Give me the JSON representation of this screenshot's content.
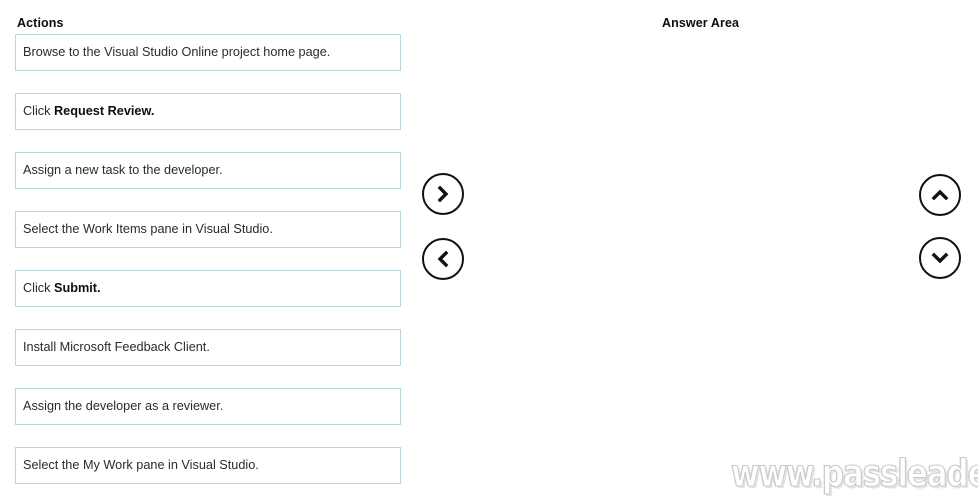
{
  "columns": {
    "actions_header": "Actions",
    "answer_header": "Answer Area"
  },
  "actions": [
    {
      "prefix": "Browse to the Visual Studio Online project home page.",
      "bold": "",
      "suffix": ""
    },
    {
      "prefix": "Click ",
      "bold": "Request Review.",
      "suffix": ""
    },
    {
      "prefix": "Assign a new task to the developer.",
      "bold": "",
      "suffix": ""
    },
    {
      "prefix": "Select the Work Items pane in Visual Studio.",
      "bold": "",
      "suffix": ""
    },
    {
      "prefix": "Click ",
      "bold": "Submit.",
      "suffix": ""
    },
    {
      "prefix": "Install Microsoft Feedback Client.",
      "bold": "",
      "suffix": ""
    },
    {
      "prefix": "Assign the developer as a reviewer.",
      "bold": "",
      "suffix": ""
    },
    {
      "prefix": "Select the My Work pane in Visual Studio.",
      "bold": "",
      "suffix": ""
    }
  ],
  "answer_items": [],
  "buttons": {
    "move_right": {
      "icon": "chevron-right-icon",
      "label": ""
    },
    "move_left": {
      "icon": "chevron-left-icon",
      "label": ""
    },
    "move_up": {
      "icon": "chevron-up-icon",
      "label": ""
    },
    "move_down": {
      "icon": "chevron-down-icon",
      "label": ""
    }
  },
  "watermark": {
    "text": "www.passleader.com"
  },
  "colors": {
    "box_border": "#bcd6dd",
    "text": "#2b2b2b",
    "header_text": "#0d0d0d",
    "button_stroke": "#111111",
    "background": "#ffffff",
    "watermark": "#d6d6dc"
  }
}
